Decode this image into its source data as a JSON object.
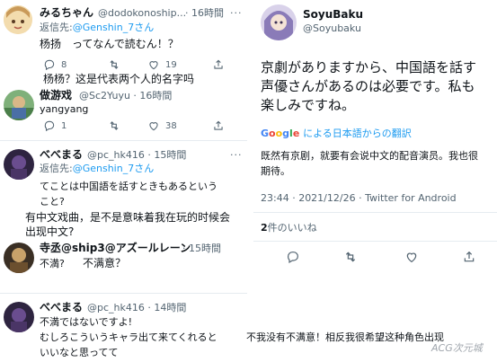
{
  "left_column": {
    "tweet1": {
      "name": "みるちゃん",
      "handle": "@dodokonoship...",
      "time": "· 16時間",
      "more": "···",
      "reply_to_prefix": "返信先:",
      "reply_to_user": "@Genshin_7さん",
      "text": "杨扬　ってなんで読むん！？",
      "replies": "8",
      "likes": "19",
      "caption": "杨杨？这是代表两个人的名字吗"
    },
    "tweet2": {
      "name": "做游戏",
      "handle": "@Sc2Yuyu · 16時間",
      "text": "yangyang",
      "replies": "1",
      "likes": "38"
    },
    "tweet3": {
      "name": "べべまる",
      "handle": "@pc_hk416 · 15時間",
      "more": "···",
      "reply_to_prefix": "返信先:",
      "reply_to_user": "@Genshin_7さん",
      "text_line1": "てことは中国語を話すときもあるという",
      "text_line2": "こと?",
      "caption_line1": "有中文戏曲，是不是意味着我在玩的时候会",
      "caption_line2": "出现中文?"
    },
    "tweet4": {
      "name": "寺丞@ship3@アズールレーン",
      "time": "· 15時間",
      "text": "不満?",
      "caption": "不满意？"
    },
    "tweet5": {
      "name": "べべまる",
      "handle": "@pc_hk416 · 14時間",
      "text_line1": "不満ではないですよ!",
      "text_line2": "むしろこういうキャラ出て来てくれると",
      "text_line3": "いいなと思ってて",
      "caption": "不我没有不满意！相反我很希望这种角色出现"
    }
  },
  "right_column": {
    "name": "SoyuBaku",
    "handle": "@Soyubaku",
    "text_line1": "京劇がありますから、中国語を話す",
    "text_line2": "声優さんがあるのは必要です。私も",
    "text_line3": "楽しみですね。",
    "translate_brand": "Google",
    "translate_label": "による日本語からの翻訳",
    "translation_line1": "既然有京剧，就要有会说中文的配音演员。我也很",
    "translation_line2": "期待。",
    "meta": "23:44 · 2021/12/26 · Twitter for Android",
    "likes_count": "2",
    "likes_label": "件のいいね"
  },
  "watermark": "ACG次元城",
  "colors": {
    "accent": "#1d9bf0",
    "muted": "#536471",
    "text": "#0f1419",
    "divider": "#e6ecf0"
  },
  "icons": [
    "reply-icon",
    "retweet-icon",
    "like-icon",
    "share-icon",
    "more-icon",
    "google-logo"
  ]
}
